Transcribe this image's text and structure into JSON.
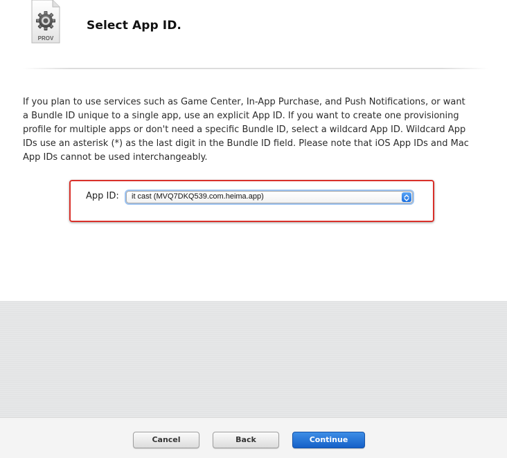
{
  "header": {
    "icon": "provisioning-profile-icon",
    "icon_caption": "PROV",
    "title": "Select App ID."
  },
  "description": "If you plan to use services such as Game Center, In-App Purchase, and Push Notifications, or want a Bundle ID unique to a single app, use an explicit App ID. If you want to create one provisioning profile for multiple apps or don't need a specific Bundle ID, select a wildcard App ID. Wildcard App IDs use an asterisk (*) as the last digit in the Bundle ID field. Please note that iOS App IDs and Mac App IDs cannot be used interchangeably.",
  "app_id": {
    "label": "App ID:",
    "selected_value": "it cast (MVQ7DKQ539.com.heima.app)",
    "highlight_color": "#d9302a"
  },
  "buttons": {
    "cancel_label": "Cancel",
    "back_label": "Back",
    "continue_label": "Continue",
    "primary_color": "#1a6fe0"
  }
}
